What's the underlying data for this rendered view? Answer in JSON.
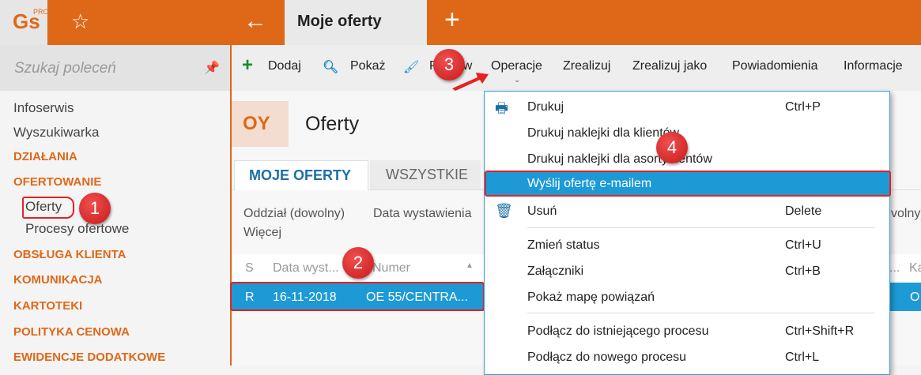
{
  "app": {
    "logo": "Gs",
    "logo_sup": "PRO",
    "tab": "Moje oferty"
  },
  "sidebar": {
    "search_placeholder": "Szukaj poleceń",
    "items": [
      {
        "label": "Infoserwis",
        "type": "item"
      },
      {
        "label": "Wyszukiwarka",
        "type": "item"
      },
      {
        "label": "DZIAŁANIA",
        "type": "section"
      },
      {
        "label": "OFERTOWANIE",
        "type": "section"
      },
      {
        "label": "Oferty",
        "type": "sub"
      },
      {
        "label": "Procesy ofertowe",
        "type": "sub"
      },
      {
        "label": "OBSŁUGA KLIENTA",
        "type": "section"
      },
      {
        "label": "KOMUNIKACJA",
        "type": "section"
      },
      {
        "label": "KARTOTEKI",
        "type": "section"
      },
      {
        "label": "POLITYKA CENOWA",
        "type": "section"
      },
      {
        "label": "EWIDENCJE DODATKOWE",
        "type": "section"
      }
    ]
  },
  "toolbar": {
    "add": "Dodaj",
    "show": "Pokaż",
    "edit": "Popraw",
    "operations": "Operacje",
    "realize": "Zrealizuj",
    "realize_as": "Zrealizuj jako",
    "notifications": "Powiadomienia",
    "info": "Informacje"
  },
  "page": {
    "badge": "OY",
    "title": "Oferty",
    "tabs": [
      "MOJE OFERTY",
      "WSZYSTKIE"
    ],
    "filters": {
      "branch": "Oddział (dowolny)",
      "date": "Data wystawienia",
      "more": "Więcej",
      "right": "volny)"
    }
  },
  "table": {
    "columns": [
      "S",
      "Data wyst...",
      "Numer",
      "...",
      "Ka"
    ],
    "rows": [
      {
        "s": "R",
        "date": "16-11-2018",
        "number": "OE 55/CENTRA...",
        "last": "O"
      }
    ]
  },
  "menu": {
    "items": [
      {
        "label": "Drukuj",
        "shortcut": "Ctrl+P"
      },
      {
        "label": "Drukuj naklejki dla klientów",
        "shortcut": ""
      },
      {
        "label": "Drukuj naklejki dla asortymentów",
        "shortcut": ""
      },
      {
        "label": "Wyślij ofertę e-mailem",
        "shortcut": ""
      },
      {
        "label": "Usuń",
        "shortcut": "Delete"
      },
      {
        "label": "Zmień status",
        "shortcut": "Ctrl+U"
      },
      {
        "label": "Załączniki",
        "shortcut": "Ctrl+B"
      },
      {
        "label": "Pokaż mapę powiązań",
        "shortcut": ""
      },
      {
        "label": "Podłącz do istniejącego procesu",
        "shortcut": "Ctrl+Shift+R"
      },
      {
        "label": "Podłącz do nowego procesu",
        "shortcut": "Ctrl+L"
      }
    ]
  },
  "annotations": [
    "1",
    "2",
    "3",
    "4"
  ]
}
